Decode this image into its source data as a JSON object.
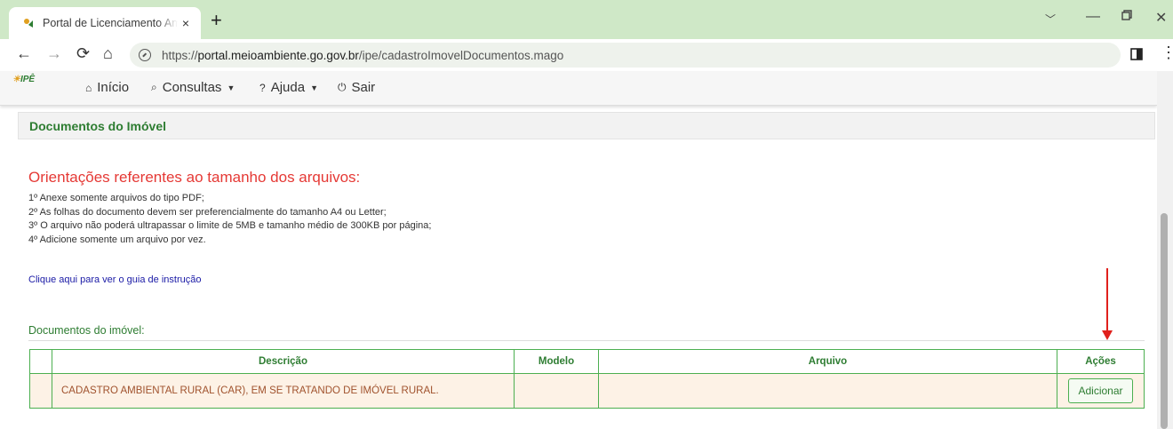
{
  "browser": {
    "tab_title": "Portal de Licenciamento Ambiental",
    "tab_close": "×",
    "new_tab": "+",
    "url_prefix": "https://",
    "url_host": "portal.meioambiente.go.gov.br",
    "url_path": "/ipe/cadastroImovelDocumentos.mago"
  },
  "navbar": {
    "logo": "IPÊ",
    "items": [
      {
        "label": "Início",
        "icon": "home-icon"
      },
      {
        "label": "Consultas",
        "icon": "search-icon"
      },
      {
        "label": "Ajuda",
        "icon": "help-icon"
      },
      {
        "label": "Sair",
        "icon": "power-icon"
      }
    ]
  },
  "page": {
    "panel_title": "Documentos do Imóvel",
    "orientation_title": "Orientações referentes ao tamanho dos arquivos:",
    "rules": [
      "1º Anexe somente arquivos do tipo PDF;",
      "2º As folhas do documento devem ser preferencialmente do tamanho A4 ou Letter;",
      "3º O arquivo não poderá ultrapassar o limite de 5MB e tamanho médio de 300KB por página;",
      "4º Adicione somente um arquivo por vez."
    ],
    "guide_link": "Clique aqui para ver o guia de instrução",
    "docs_title": "Documentos do imóvel:"
  },
  "table": {
    "headers": [
      "Descrição",
      "Modelo",
      "Arquivo",
      "Ações"
    ],
    "rows": [
      {
        "descricao": "CADASTRO AMBIENTAL RURAL (CAR), EM SE TRATANDO DE IMÓVEL RURAL.",
        "modelo": "",
        "arquivo": "",
        "acao_label": "Adicionar"
      }
    ]
  },
  "colors": {
    "accent_green": "#2e7d32",
    "warning_red": "#e53935",
    "tabbar_bg": "#cfe8c7",
    "row_bg": "#fdf2e6",
    "annotation_arrow": "#e0201c"
  }
}
